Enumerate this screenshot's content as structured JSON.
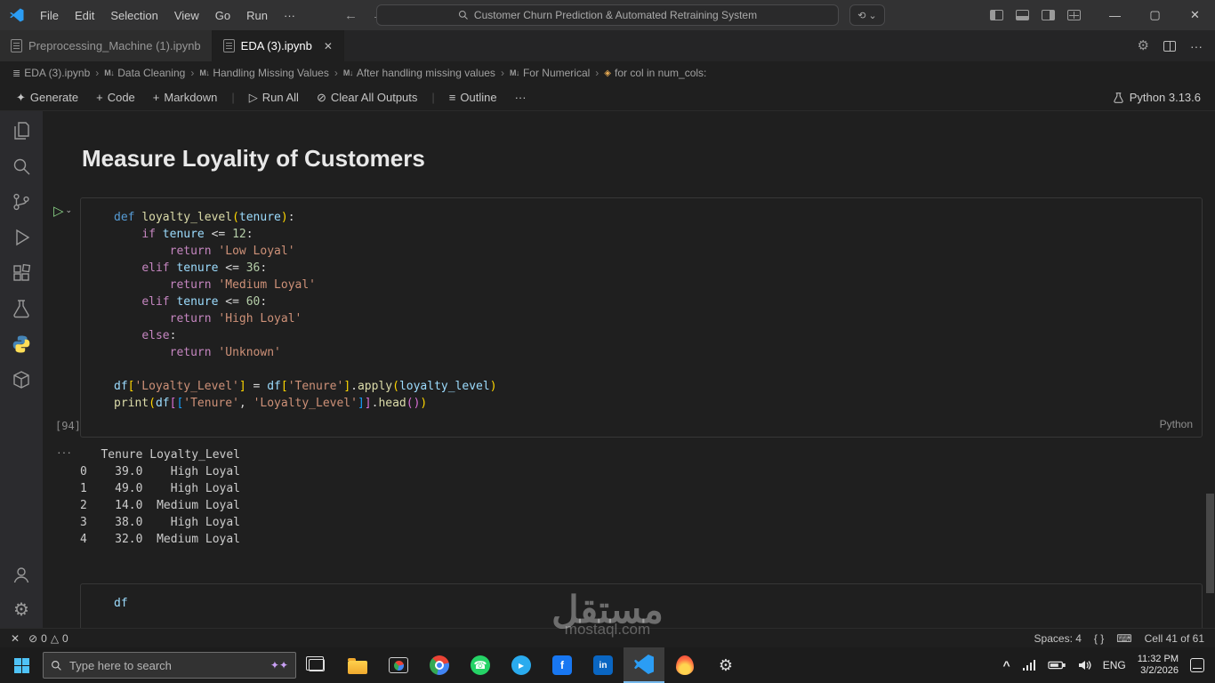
{
  "window": {
    "menus": [
      "File",
      "Edit",
      "Selection",
      "View",
      "Go",
      "Run",
      "···"
    ],
    "search_title": "Customer Churn Prediction & Automated Retraining System",
    "back_arrow": "←",
    "forward_arrow": "→",
    "minimize": "—",
    "maximize": "▢",
    "close": "✕"
  },
  "tabs": {
    "inactive": "Preprocessing_Machine (1).ipynb",
    "active": "EDA (3).ipynb",
    "close_glyph": "✕",
    "more": "···"
  },
  "breadcrumb": {
    "items": [
      {
        "label": "EDA (3).ipynb",
        "icon": "notebook"
      },
      {
        "label": "Data Cleaning",
        "icon": "markdown"
      },
      {
        "label": "Handling Missing Values",
        "icon": "markdown"
      },
      {
        "label": "After handling missing values",
        "icon": "markdown"
      },
      {
        "label": "For Numerical",
        "icon": "markdown"
      },
      {
        "label": "for col in num_cols:",
        "icon": "symbol"
      }
    ]
  },
  "toolbar": {
    "generate": "Generate",
    "code": "Code",
    "markdown": "Markdown",
    "run_all": "Run All",
    "clear_outputs": "Clear All Outputs",
    "outline": "Outline",
    "more": "···",
    "kernel": "Python 3.13.6",
    "plus": "+",
    "sparkle": "✦",
    "play": "▷",
    "clear_icon": "⊘",
    "list_icon": "≡"
  },
  "notebook": {
    "heading": "Measure Loyality of Customers",
    "execution_count": "[94]",
    "cell_language": "Python",
    "run_glyph": "▷",
    "run_chevron": "⌄",
    "output_actions": "···"
  },
  "code_cell": {
    "token_colors": {
      "kw": "#569cd6",
      "ctrl": "#c586c0",
      "fn": "#dcdcaa",
      "var": "#9cdcfe",
      "num": "#b5cea8",
      "str": "#ce9178",
      "op": "#d4d4d4",
      "txt": "#d4d4d4",
      "b1": "#ffd700",
      "b2": "#da70d6",
      "b3": "#179fff"
    },
    "lines": [
      [
        {
          "t": "kw",
          "v": "def "
        },
        {
          "t": "fn",
          "v": "loyalty_level"
        },
        {
          "t": "b1",
          "v": "("
        },
        {
          "t": "var",
          "v": "tenure"
        },
        {
          "t": "b1",
          "v": ")"
        },
        {
          "t": "op",
          "v": ":"
        }
      ],
      [
        {
          "t": "txt",
          "v": "    "
        },
        {
          "t": "ctrl",
          "v": "if "
        },
        {
          "t": "var",
          "v": "tenure"
        },
        {
          "t": "op",
          "v": " <= "
        },
        {
          "t": "num",
          "v": "12"
        },
        {
          "t": "op",
          "v": ":"
        }
      ],
      [
        {
          "t": "txt",
          "v": "        "
        },
        {
          "t": "ctrl",
          "v": "return "
        },
        {
          "t": "str",
          "v": "'Low Loyal'"
        }
      ],
      [
        {
          "t": "txt",
          "v": "    "
        },
        {
          "t": "ctrl",
          "v": "elif "
        },
        {
          "t": "var",
          "v": "tenure"
        },
        {
          "t": "op",
          "v": " <= "
        },
        {
          "t": "num",
          "v": "36"
        },
        {
          "t": "op",
          "v": ":"
        }
      ],
      [
        {
          "t": "txt",
          "v": "        "
        },
        {
          "t": "ctrl",
          "v": "return "
        },
        {
          "t": "str",
          "v": "'Medium Loyal'"
        }
      ],
      [
        {
          "t": "txt",
          "v": "    "
        },
        {
          "t": "ctrl",
          "v": "elif "
        },
        {
          "t": "var",
          "v": "tenure"
        },
        {
          "t": "op",
          "v": " <= "
        },
        {
          "t": "num",
          "v": "60"
        },
        {
          "t": "op",
          "v": ":"
        }
      ],
      [
        {
          "t": "txt",
          "v": "        "
        },
        {
          "t": "ctrl",
          "v": "return "
        },
        {
          "t": "str",
          "v": "'High Loyal'"
        }
      ],
      [
        {
          "t": "txt",
          "v": "    "
        },
        {
          "t": "ctrl",
          "v": "else"
        },
        {
          "t": "op",
          "v": ":"
        }
      ],
      [
        {
          "t": "txt",
          "v": "        "
        },
        {
          "t": "ctrl",
          "v": "return "
        },
        {
          "t": "str",
          "v": "'Unknown'"
        }
      ],
      [],
      [
        {
          "t": "var",
          "v": "df"
        },
        {
          "t": "b1",
          "v": "["
        },
        {
          "t": "str",
          "v": "'Loyalty_Level'"
        },
        {
          "t": "b1",
          "v": "]"
        },
        {
          "t": "op",
          "v": " = "
        },
        {
          "t": "var",
          "v": "df"
        },
        {
          "t": "b1",
          "v": "["
        },
        {
          "t": "str",
          "v": "'Tenure'"
        },
        {
          "t": "b1",
          "v": "]"
        },
        {
          "t": "op",
          "v": "."
        },
        {
          "t": "fn",
          "v": "apply"
        },
        {
          "t": "b1",
          "v": "("
        },
        {
          "t": "var",
          "v": "loyalty_level"
        },
        {
          "t": "b1",
          "v": ")"
        }
      ],
      [
        {
          "t": "fn",
          "v": "print"
        },
        {
          "t": "b1",
          "v": "("
        },
        {
          "t": "var",
          "v": "df"
        },
        {
          "t": "b2",
          "v": "["
        },
        {
          "t": "b3",
          "v": "["
        },
        {
          "t": "str",
          "v": "'Tenure'"
        },
        {
          "t": "op",
          "v": ", "
        },
        {
          "t": "str",
          "v": "'Loyalty_Level'"
        },
        {
          "t": "b3",
          "v": "]"
        },
        {
          "t": "b2",
          "v": "]"
        },
        {
          "t": "op",
          "v": "."
        },
        {
          "t": "fn",
          "v": "head"
        },
        {
          "t": "b2",
          "v": "("
        },
        {
          "t": "b2",
          "v": ")"
        },
        {
          "t": "b1",
          "v": ")"
        }
      ]
    ],
    "next_cell_lines": [
      [
        {
          "t": "var",
          "v": "df"
        }
      ]
    ]
  },
  "output_cell": {
    "lines": [
      "   Tenure Loyalty_Level",
      "0    39.0    High Loyal",
      "1    49.0    High Loyal",
      "2    14.0  Medium Loyal",
      "3    38.0    High Loyal",
      "4    32.0  Medium Loyal"
    ]
  },
  "status_bar": {
    "remote_glyph": "✕",
    "error_icon": "⊘",
    "errors": "0",
    "warning_icon": "△",
    "warnings": "0",
    "spaces": "Spaces: 4",
    "braces": "{ }",
    "keyboard_icon": "⌨",
    "cell_position": "Cell 41 of 61"
  },
  "taskbar": {
    "search_placeholder": "Type here to search",
    "search_stars": "✦✦",
    "facebook_letter": "f",
    "linkedin_letters": "in",
    "whatsapp_glyph": "☎",
    "telegram_glyph": "▸",
    "hidden_icons": "^",
    "language": "ENG",
    "time": "11:32 PM",
    "date": "3/2/2026"
  },
  "watermark": {
    "arabic": "مستقل",
    "domain": "mostaql.com"
  }
}
